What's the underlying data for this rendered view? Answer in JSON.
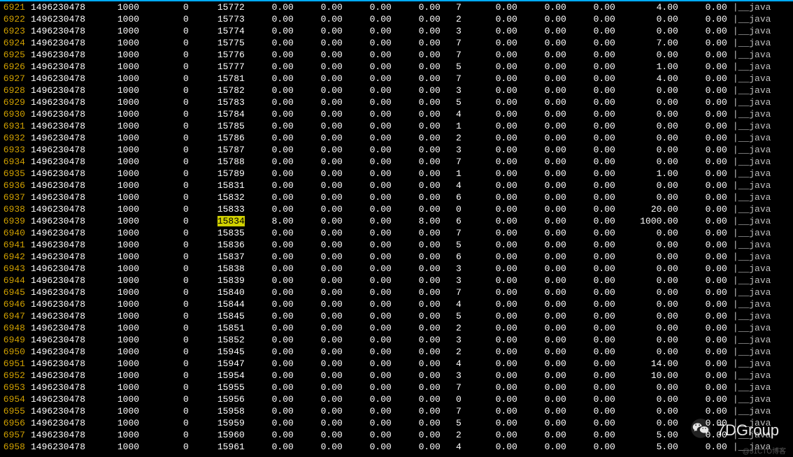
{
  "watermark": "7DGroup",
  "faint_text": "@51CTO博客",
  "command_label": "|__java",
  "rows": [
    {
      "ln": "6921",
      "c1": "1496230478",
      "c2": "1000",
      "c3": "0",
      "c4": "15772",
      "c5": "0.00",
      "c6": "0.00",
      "c7": "0.00",
      "c8": "0.00",
      "c9": "7",
      "c10": "0.00",
      "c11": "0.00",
      "c12": "0.00",
      "c13": "4.00",
      "c14": "0.00",
      "hl": false
    },
    {
      "ln": "6922",
      "c1": "1496230478",
      "c2": "1000",
      "c3": "0",
      "c4": "15773",
      "c5": "0.00",
      "c6": "0.00",
      "c7": "0.00",
      "c8": "0.00",
      "c9": "2",
      "c10": "0.00",
      "c11": "0.00",
      "c12": "0.00",
      "c13": "0.00",
      "c14": "0.00",
      "hl": false
    },
    {
      "ln": "6923",
      "c1": "1496230478",
      "c2": "1000",
      "c3": "0",
      "c4": "15774",
      "c5": "0.00",
      "c6": "0.00",
      "c7": "0.00",
      "c8": "0.00",
      "c9": "3",
      "c10": "0.00",
      "c11": "0.00",
      "c12": "0.00",
      "c13": "0.00",
      "c14": "0.00",
      "hl": false
    },
    {
      "ln": "6924",
      "c1": "1496230478",
      "c2": "1000",
      "c3": "0",
      "c4": "15775",
      "c5": "0.00",
      "c6": "0.00",
      "c7": "0.00",
      "c8": "0.00",
      "c9": "7",
      "c10": "0.00",
      "c11": "0.00",
      "c12": "0.00",
      "c13": "7.00",
      "c14": "0.00",
      "hl": false
    },
    {
      "ln": "6925",
      "c1": "1496230478",
      "c2": "1000",
      "c3": "0",
      "c4": "15776",
      "c5": "0.00",
      "c6": "0.00",
      "c7": "0.00",
      "c8": "0.00",
      "c9": "7",
      "c10": "0.00",
      "c11": "0.00",
      "c12": "0.00",
      "c13": "0.00",
      "c14": "0.00",
      "hl": false
    },
    {
      "ln": "6926",
      "c1": "1496230478",
      "c2": "1000",
      "c3": "0",
      "c4": "15777",
      "c5": "0.00",
      "c6": "0.00",
      "c7": "0.00",
      "c8": "0.00",
      "c9": "5",
      "c10": "0.00",
      "c11": "0.00",
      "c12": "0.00",
      "c13": "1.00",
      "c14": "0.00",
      "hl": false
    },
    {
      "ln": "6927",
      "c1": "1496230478",
      "c2": "1000",
      "c3": "0",
      "c4": "15781",
      "c5": "0.00",
      "c6": "0.00",
      "c7": "0.00",
      "c8": "0.00",
      "c9": "7",
      "c10": "0.00",
      "c11": "0.00",
      "c12": "0.00",
      "c13": "4.00",
      "c14": "0.00",
      "hl": false
    },
    {
      "ln": "6928",
      "c1": "1496230478",
      "c2": "1000",
      "c3": "0",
      "c4": "15782",
      "c5": "0.00",
      "c6": "0.00",
      "c7": "0.00",
      "c8": "0.00",
      "c9": "3",
      "c10": "0.00",
      "c11": "0.00",
      "c12": "0.00",
      "c13": "0.00",
      "c14": "0.00",
      "hl": false
    },
    {
      "ln": "6929",
      "c1": "1496230478",
      "c2": "1000",
      "c3": "0",
      "c4": "15783",
      "c5": "0.00",
      "c6": "0.00",
      "c7": "0.00",
      "c8": "0.00",
      "c9": "5",
      "c10": "0.00",
      "c11": "0.00",
      "c12": "0.00",
      "c13": "0.00",
      "c14": "0.00",
      "hl": false
    },
    {
      "ln": "6930",
      "c1": "1496230478",
      "c2": "1000",
      "c3": "0",
      "c4": "15784",
      "c5": "0.00",
      "c6": "0.00",
      "c7": "0.00",
      "c8": "0.00",
      "c9": "4",
      "c10": "0.00",
      "c11": "0.00",
      "c12": "0.00",
      "c13": "0.00",
      "c14": "0.00",
      "hl": false
    },
    {
      "ln": "6931",
      "c1": "1496230478",
      "c2": "1000",
      "c3": "0",
      "c4": "15785",
      "c5": "0.00",
      "c6": "0.00",
      "c7": "0.00",
      "c8": "0.00",
      "c9": "1",
      "c10": "0.00",
      "c11": "0.00",
      "c12": "0.00",
      "c13": "0.00",
      "c14": "0.00",
      "hl": false
    },
    {
      "ln": "6932",
      "c1": "1496230478",
      "c2": "1000",
      "c3": "0",
      "c4": "15786",
      "c5": "0.00",
      "c6": "0.00",
      "c7": "0.00",
      "c8": "0.00",
      "c9": "2",
      "c10": "0.00",
      "c11": "0.00",
      "c12": "0.00",
      "c13": "0.00",
      "c14": "0.00",
      "hl": false
    },
    {
      "ln": "6933",
      "c1": "1496230478",
      "c2": "1000",
      "c3": "0",
      "c4": "15787",
      "c5": "0.00",
      "c6": "0.00",
      "c7": "0.00",
      "c8": "0.00",
      "c9": "3",
      "c10": "0.00",
      "c11": "0.00",
      "c12": "0.00",
      "c13": "0.00",
      "c14": "0.00",
      "hl": false
    },
    {
      "ln": "6934",
      "c1": "1496230478",
      "c2": "1000",
      "c3": "0",
      "c4": "15788",
      "c5": "0.00",
      "c6": "0.00",
      "c7": "0.00",
      "c8": "0.00",
      "c9": "7",
      "c10": "0.00",
      "c11": "0.00",
      "c12": "0.00",
      "c13": "0.00",
      "c14": "0.00",
      "hl": false
    },
    {
      "ln": "6935",
      "c1": "1496230478",
      "c2": "1000",
      "c3": "0",
      "c4": "15789",
      "c5": "0.00",
      "c6": "0.00",
      "c7": "0.00",
      "c8": "0.00",
      "c9": "1",
      "c10": "0.00",
      "c11": "0.00",
      "c12": "0.00",
      "c13": "1.00",
      "c14": "0.00",
      "hl": false
    },
    {
      "ln": "6936",
      "c1": "1496230478",
      "c2": "1000",
      "c3": "0",
      "c4": "15831",
      "c5": "0.00",
      "c6": "0.00",
      "c7": "0.00",
      "c8": "0.00",
      "c9": "4",
      "c10": "0.00",
      "c11": "0.00",
      "c12": "0.00",
      "c13": "0.00",
      "c14": "0.00",
      "hl": false
    },
    {
      "ln": "6937",
      "c1": "1496230478",
      "c2": "1000",
      "c3": "0",
      "c4": "15832",
      "c5": "0.00",
      "c6": "0.00",
      "c7": "0.00",
      "c8": "0.00",
      "c9": "6",
      "c10": "0.00",
      "c11": "0.00",
      "c12": "0.00",
      "c13": "0.00",
      "c14": "0.00",
      "hl": false
    },
    {
      "ln": "6938",
      "c1": "1496230478",
      "c2": "1000",
      "c3": "0",
      "c4": "15833",
      "c5": "0.00",
      "c6": "0.00",
      "c7": "0.00",
      "c8": "0.00",
      "c9": "0",
      "c10": "0.00",
      "c11": "0.00",
      "c12": "0.00",
      "c13": "20.00",
      "c14": "0.00",
      "hl": false
    },
    {
      "ln": "6939",
      "c1": "1496230478",
      "c2": "1000",
      "c3": "0",
      "c4": "15834",
      "c5": "8.00",
      "c6": "0.00",
      "c7": "0.00",
      "c8": "8.00",
      "c9": "6",
      "c10": "0.00",
      "c11": "0.00",
      "c12": "0.00",
      "c13": "1000.00",
      "c14": "0.00",
      "hl": true
    },
    {
      "ln": "6940",
      "c1": "1496230478",
      "c2": "1000",
      "c3": "0",
      "c4": "15835",
      "c5": "0.00",
      "c6": "0.00",
      "c7": "0.00",
      "c8": "0.00",
      "c9": "7",
      "c10": "0.00",
      "c11": "0.00",
      "c12": "0.00",
      "c13": "0.00",
      "c14": "0.00",
      "hl": false
    },
    {
      "ln": "6941",
      "c1": "1496230478",
      "c2": "1000",
      "c3": "0",
      "c4": "15836",
      "c5": "0.00",
      "c6": "0.00",
      "c7": "0.00",
      "c8": "0.00",
      "c9": "5",
      "c10": "0.00",
      "c11": "0.00",
      "c12": "0.00",
      "c13": "0.00",
      "c14": "0.00",
      "hl": false
    },
    {
      "ln": "6942",
      "c1": "1496230478",
      "c2": "1000",
      "c3": "0",
      "c4": "15837",
      "c5": "0.00",
      "c6": "0.00",
      "c7": "0.00",
      "c8": "0.00",
      "c9": "6",
      "c10": "0.00",
      "c11": "0.00",
      "c12": "0.00",
      "c13": "0.00",
      "c14": "0.00",
      "hl": false
    },
    {
      "ln": "6943",
      "c1": "1496230478",
      "c2": "1000",
      "c3": "0",
      "c4": "15838",
      "c5": "0.00",
      "c6": "0.00",
      "c7": "0.00",
      "c8": "0.00",
      "c9": "3",
      "c10": "0.00",
      "c11": "0.00",
      "c12": "0.00",
      "c13": "0.00",
      "c14": "0.00",
      "hl": false
    },
    {
      "ln": "6944",
      "c1": "1496230478",
      "c2": "1000",
      "c3": "0",
      "c4": "15839",
      "c5": "0.00",
      "c6": "0.00",
      "c7": "0.00",
      "c8": "0.00",
      "c9": "3",
      "c10": "0.00",
      "c11": "0.00",
      "c12": "0.00",
      "c13": "0.00",
      "c14": "0.00",
      "hl": false
    },
    {
      "ln": "6945",
      "c1": "1496230478",
      "c2": "1000",
      "c3": "0",
      "c4": "15840",
      "c5": "0.00",
      "c6": "0.00",
      "c7": "0.00",
      "c8": "0.00",
      "c9": "7",
      "c10": "0.00",
      "c11": "0.00",
      "c12": "0.00",
      "c13": "0.00",
      "c14": "0.00",
      "hl": false
    },
    {
      "ln": "6946",
      "c1": "1496230478",
      "c2": "1000",
      "c3": "0",
      "c4": "15844",
      "c5": "0.00",
      "c6": "0.00",
      "c7": "0.00",
      "c8": "0.00",
      "c9": "4",
      "c10": "0.00",
      "c11": "0.00",
      "c12": "0.00",
      "c13": "0.00",
      "c14": "0.00",
      "hl": false
    },
    {
      "ln": "6947",
      "c1": "1496230478",
      "c2": "1000",
      "c3": "0",
      "c4": "15845",
      "c5": "0.00",
      "c6": "0.00",
      "c7": "0.00",
      "c8": "0.00",
      "c9": "5",
      "c10": "0.00",
      "c11": "0.00",
      "c12": "0.00",
      "c13": "0.00",
      "c14": "0.00",
      "hl": false
    },
    {
      "ln": "6948",
      "c1": "1496230478",
      "c2": "1000",
      "c3": "0",
      "c4": "15851",
      "c5": "0.00",
      "c6": "0.00",
      "c7": "0.00",
      "c8": "0.00",
      "c9": "2",
      "c10": "0.00",
      "c11": "0.00",
      "c12": "0.00",
      "c13": "0.00",
      "c14": "0.00",
      "hl": false
    },
    {
      "ln": "6949",
      "c1": "1496230478",
      "c2": "1000",
      "c3": "0",
      "c4": "15852",
      "c5": "0.00",
      "c6": "0.00",
      "c7": "0.00",
      "c8": "0.00",
      "c9": "3",
      "c10": "0.00",
      "c11": "0.00",
      "c12": "0.00",
      "c13": "0.00",
      "c14": "0.00",
      "hl": false
    },
    {
      "ln": "6950",
      "c1": "1496230478",
      "c2": "1000",
      "c3": "0",
      "c4": "15945",
      "c5": "0.00",
      "c6": "0.00",
      "c7": "0.00",
      "c8": "0.00",
      "c9": "2",
      "c10": "0.00",
      "c11": "0.00",
      "c12": "0.00",
      "c13": "0.00",
      "c14": "0.00",
      "hl": false
    },
    {
      "ln": "6951",
      "c1": "1496230478",
      "c2": "1000",
      "c3": "0",
      "c4": "15947",
      "c5": "0.00",
      "c6": "0.00",
      "c7": "0.00",
      "c8": "0.00",
      "c9": "4",
      "c10": "0.00",
      "c11": "0.00",
      "c12": "0.00",
      "c13": "14.00",
      "c14": "0.00",
      "hl": false
    },
    {
      "ln": "6952",
      "c1": "1496230478",
      "c2": "1000",
      "c3": "0",
      "c4": "15954",
      "c5": "0.00",
      "c6": "0.00",
      "c7": "0.00",
      "c8": "0.00",
      "c9": "3",
      "c10": "0.00",
      "c11": "0.00",
      "c12": "0.00",
      "c13": "10.00",
      "c14": "0.00",
      "hl": false
    },
    {
      "ln": "6953",
      "c1": "1496230478",
      "c2": "1000",
      "c3": "0",
      "c4": "15955",
      "c5": "0.00",
      "c6": "0.00",
      "c7": "0.00",
      "c8": "0.00",
      "c9": "7",
      "c10": "0.00",
      "c11": "0.00",
      "c12": "0.00",
      "c13": "0.00",
      "c14": "0.00",
      "hl": false
    },
    {
      "ln": "6954",
      "c1": "1496230478",
      "c2": "1000",
      "c3": "0",
      "c4": "15956",
      "c5": "0.00",
      "c6": "0.00",
      "c7": "0.00",
      "c8": "0.00",
      "c9": "0",
      "c10": "0.00",
      "c11": "0.00",
      "c12": "0.00",
      "c13": "0.00",
      "c14": "0.00",
      "hl": false
    },
    {
      "ln": "6955",
      "c1": "1496230478",
      "c2": "1000",
      "c3": "0",
      "c4": "15958",
      "c5": "0.00",
      "c6": "0.00",
      "c7": "0.00",
      "c8": "0.00",
      "c9": "7",
      "c10": "0.00",
      "c11": "0.00",
      "c12": "0.00",
      "c13": "0.00",
      "c14": "0.00",
      "hl": false
    },
    {
      "ln": "6956",
      "c1": "1496230478",
      "c2": "1000",
      "c3": "0",
      "c4": "15959",
      "c5": "0.00",
      "c6": "0.00",
      "c7": "0.00",
      "c8": "0.00",
      "c9": "5",
      "c10": "0.00",
      "c11": "0.00",
      "c12": "0.00",
      "c13": "0.00",
      "c14": "0.00",
      "hl": false
    },
    {
      "ln": "6957",
      "c1": "1496230478",
      "c2": "1000",
      "c3": "0",
      "c4": "15960",
      "c5": "0.00",
      "c6": "0.00",
      "c7": "0.00",
      "c8": "0.00",
      "c9": "2",
      "c10": "0.00",
      "c11": "0.00",
      "c12": "0.00",
      "c13": "5.00",
      "c14": "0.00",
      "hl": false
    },
    {
      "ln": "6958",
      "c1": "1496230478",
      "c2": "1000",
      "c3": "0",
      "c4": "15961",
      "c5": "0.00",
      "c6": "0.00",
      "c7": "0.00",
      "c8": "0.00",
      "c9": "4",
      "c10": "0.00",
      "c11": "0.00",
      "c12": "0.00",
      "c13": "5.00",
      "c14": "0.00",
      "hl": false
    }
  ]
}
